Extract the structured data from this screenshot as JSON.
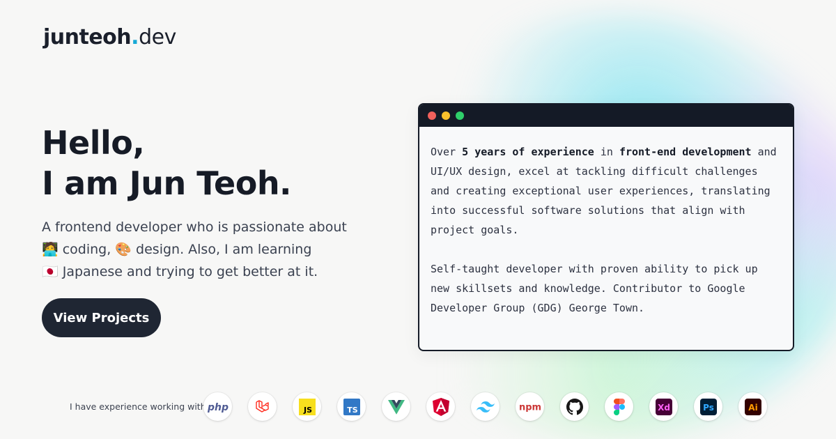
{
  "brand": {
    "name": "junteoh",
    "dot": ".",
    "tld": "dev"
  },
  "hero": {
    "line1": "Hello,",
    "line2": "I am Jun Teoh.",
    "desc_line1": "A frontend developer who is passionate about",
    "desc_line2_emoji1": "🧑‍💻",
    "desc_line2_a": "coding,",
    "desc_line2_emoji2": "🎨",
    "desc_line2_b": "design. Also, I am learning",
    "desc_line3_emoji": "🇯🇵",
    "desc_line3": "Japanese and trying to get better at it.",
    "cta": "View Projects"
  },
  "window": {
    "p1_a": "Over ",
    "p1_b": "5 years of experience",
    "p1_c": " in ",
    "p1_d": "front-end development",
    "p1_e": " and UI/UX design, excel at tackling difficult challenges and creating exceptional user experiences, translating into successful software solutions that align with project goals.",
    "p2": "Self-taught developer with proven ability to pick up new skillsets and knowledge. Contributor to Google Developer Group (GDG) George Town."
  },
  "footer": {
    "label": "I have experience working with",
    "skills": [
      {
        "icon": "php-icon",
        "text": "php",
        "color": "#4f5b93"
      },
      {
        "icon": "laravel-icon",
        "color": "#ff2d20"
      },
      {
        "icon": "javascript-icon",
        "text": "JS",
        "color": "#f7df1e"
      },
      {
        "icon": "typescript-icon",
        "text": "TS",
        "color": "#3178c6"
      },
      {
        "icon": "vue-icon",
        "color": "#41b883"
      },
      {
        "icon": "angular-icon",
        "color": "#dd0031"
      },
      {
        "icon": "tailwind-icon",
        "color": "#38bdf8"
      },
      {
        "icon": "npm-icon",
        "text": "npm",
        "color": "#cb3837"
      },
      {
        "icon": "github-icon",
        "color": "#181717"
      },
      {
        "icon": "figma-icon",
        "color": "#a259ff"
      },
      {
        "icon": "adobe-xd-icon",
        "text": "Xd",
        "color": "#470137"
      },
      {
        "icon": "photoshop-icon",
        "text": "Ps",
        "color": "#001e36"
      },
      {
        "icon": "illustrator-icon",
        "text": "Ai",
        "color": "#330000"
      }
    ]
  }
}
